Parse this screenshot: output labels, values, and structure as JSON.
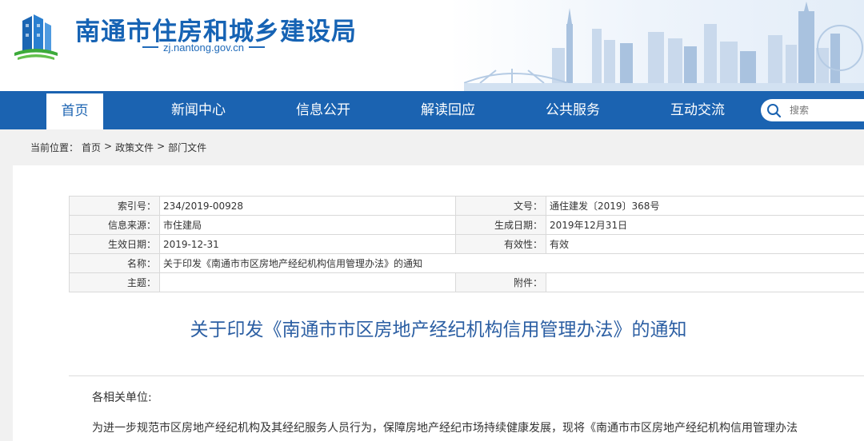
{
  "header": {
    "site_title": "南通市住房和城乡建设局",
    "site_domain": "zj.nantong.gov.cn"
  },
  "nav": {
    "items": [
      "首页",
      "新闻中心",
      "信息公开",
      "解读回应",
      "公共服务",
      "互动交流"
    ],
    "active_index": 0
  },
  "search": {
    "placeholder": "搜索"
  },
  "breadcrumb": {
    "prefix": "当前位置：",
    "items": [
      "首页",
      "政策文件",
      "部门文件"
    ],
    "separator": ">"
  },
  "meta": {
    "index_no_label": "索引号：",
    "index_no": "234/2019-00928",
    "doc_no_label": "文号：",
    "doc_no": "通住建发〔2019〕368号",
    "source_label": "信息来源：",
    "source": "市住建局",
    "created_label": "生成日期：",
    "created": "2019年12月31日",
    "effective_label": "生效日期：",
    "effective": "2019-12-31",
    "validity_label": "有效性：",
    "validity": "有效",
    "name_label": "名称：",
    "name": "关于印发《南通市市区房地产经纪机构信用管理办法》的通知",
    "subject_label": "主题：",
    "subject": "",
    "attachment_label": "附件：",
    "attachment": ""
  },
  "article": {
    "title": "关于印发《南通市市区房地产经纪机构信用管理办法》的通知",
    "salutation": "各相关单位:",
    "paragraph1": "为进一步规范市区房地产经纪机构及其经纪服务人员行为，保障房地产经纪市场持续健康发展，现将《南通市市区房地产经纪机构信用管理办法"
  },
  "colors": {
    "brand_blue": "#1b63b1",
    "title_blue": "#1663b4",
    "article_title": "#2c5fa3"
  },
  "icons": {
    "logo": "building-logo-icon",
    "search": "search-icon",
    "skyline": "city-skyline-icon"
  }
}
